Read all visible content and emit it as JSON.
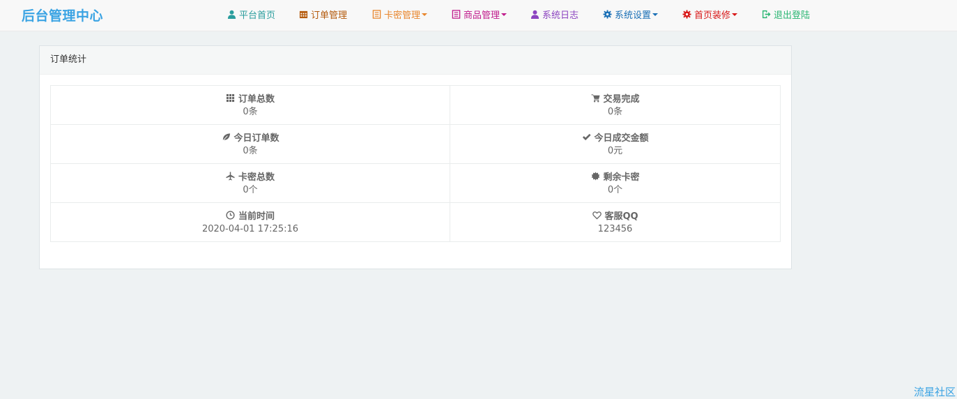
{
  "brand": "后台管理中心",
  "nav": [
    {
      "label": "平台首页",
      "icon": "user-icon",
      "color": "#2a9d9d",
      "dropdown": false
    },
    {
      "label": "订单管理",
      "icon": "calendar-icon",
      "color": "#b45a0c",
      "dropdown": false
    },
    {
      "label": "卡密管理",
      "icon": "list-alt-icon",
      "color": "#e8862d",
      "dropdown": true
    },
    {
      "label": "商品管理",
      "icon": "list-alt-icon",
      "color": "#c01c8c",
      "dropdown": true
    },
    {
      "label": "系统日志",
      "icon": "user-icon",
      "color": "#8c44c0",
      "dropdown": false
    },
    {
      "label": "系统设置",
      "icon": "cog-icon",
      "color": "#1a6fb5",
      "dropdown": true
    },
    {
      "label": "首页装修",
      "icon": "cog-icon",
      "color": "#d81818",
      "dropdown": true
    },
    {
      "label": "退出登陆",
      "icon": "log-out-icon",
      "color": "#2bb673",
      "dropdown": false
    }
  ],
  "panel": {
    "title": "订单统计",
    "rows": [
      [
        {
          "label": "订单总数",
          "value": "0条",
          "icon": "th-icon"
        },
        {
          "label": "交易完成",
          "value": "0条",
          "icon": "shopping-cart-icon"
        }
      ],
      [
        {
          "label": "今日订单数",
          "value": "0条",
          "icon": "leaf-icon"
        },
        {
          "label": "今日成交金额",
          "value": "0元",
          "icon": "ok-icon"
        }
      ],
      [
        {
          "label": "卡密总数",
          "value": "0个",
          "icon": "plane-icon"
        },
        {
          "label": "剩余卡密",
          "value": "0个",
          "icon": "certificate-icon"
        }
      ],
      [
        {
          "label": "当前时间",
          "value": "2020-04-01 17:25:16",
          "icon": "time-icon"
        },
        {
          "label": "客服QQ",
          "value": "123456",
          "icon": "heart-empty-icon"
        }
      ]
    ]
  },
  "watermark": "流星社区"
}
